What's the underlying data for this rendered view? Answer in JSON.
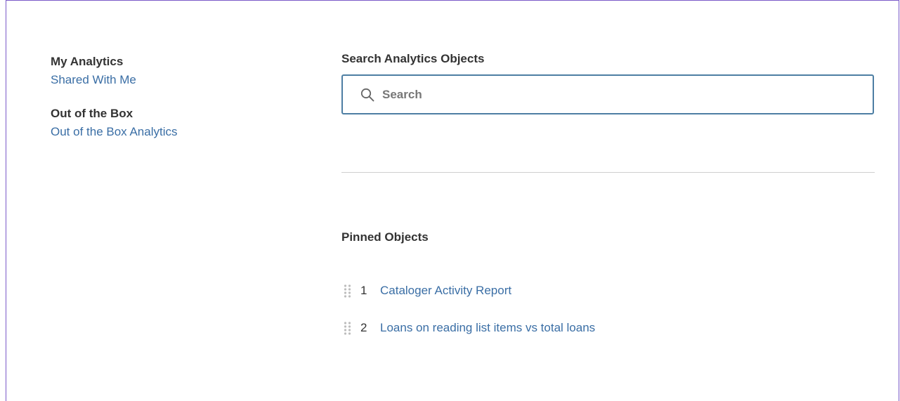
{
  "sidebar": {
    "sections": [
      {
        "heading": "My Analytics",
        "link": "Shared With Me"
      },
      {
        "heading": "Out of the Box",
        "link": "Out of the Box Analytics"
      }
    ]
  },
  "search": {
    "title": "Search Analytics Objects",
    "placeholder": "Search",
    "value": "",
    "icon": "search-icon"
  },
  "pinned": {
    "title": "Pinned Objects",
    "items": [
      {
        "index": "1",
        "label": "Cataloger Activity Report"
      },
      {
        "index": "2",
        "label": "Loans on reading list items vs total loans"
      }
    ]
  },
  "colors": {
    "link": "#3a6ea5",
    "border_accent": "#7a5ac8",
    "search_border": "#4d7ea3"
  }
}
